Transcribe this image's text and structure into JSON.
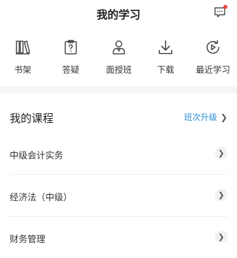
{
  "header": {
    "title": "我的学习",
    "message_icon": "message-icon"
  },
  "quick_actions": [
    {
      "label": "书架",
      "icon": "bookshelf-icon"
    },
    {
      "label": "答疑",
      "icon": "question-clipboard-icon"
    },
    {
      "label": "面授班",
      "icon": "teacher-icon"
    },
    {
      "label": "下载",
      "icon": "download-icon"
    },
    {
      "label": "最近学习",
      "icon": "recent-play-icon"
    }
  ],
  "courses": {
    "title": "我的课程",
    "upgrade_label": "班次升级",
    "items": [
      {
        "label": "中级会计实务"
      },
      {
        "label": "经济法（中级）"
      },
      {
        "label": "财务管理"
      }
    ]
  },
  "colors": {
    "accent": "#2b8fd6",
    "badge": "#f0463c"
  }
}
